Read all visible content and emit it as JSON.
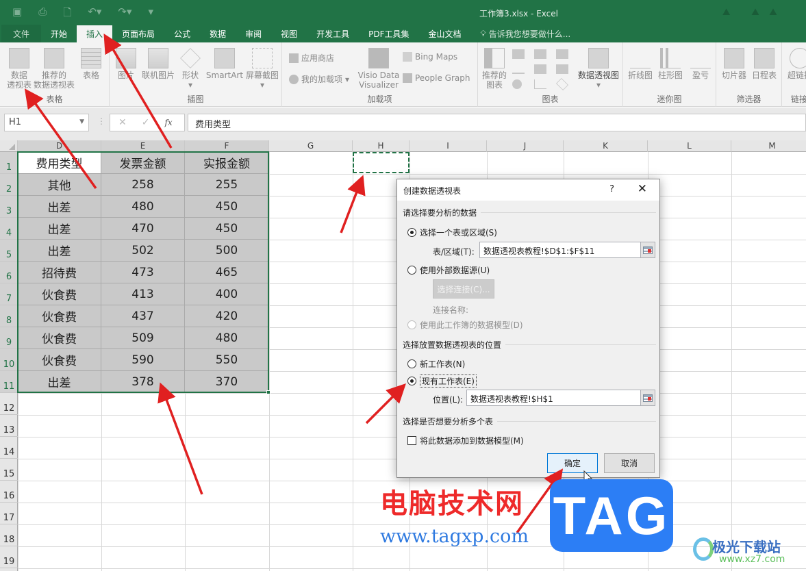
{
  "window": {
    "title": "工作簿3.xlsx - Excel"
  },
  "quick_access": [
    "save-icon",
    "print-preview-icon",
    "print-icon",
    "undo-icon",
    "redo-icon",
    "customize-icon"
  ],
  "tabs": [
    {
      "label": "文件",
      "type": "file"
    },
    {
      "label": "开始"
    },
    {
      "label": "插入",
      "active": true
    },
    {
      "label": "页面布局"
    },
    {
      "label": "公式"
    },
    {
      "label": "数据"
    },
    {
      "label": "审阅"
    },
    {
      "label": "视图"
    },
    {
      "label": "开发工具"
    },
    {
      "label": "PDF工具集"
    },
    {
      "label": "金山文档"
    }
  ],
  "tell_me": "告诉我您想要做什么...",
  "ribbon": {
    "groups": {
      "tables": "表格",
      "illustrations": "插图",
      "addins": "加载项",
      "charts": "图表",
      "sparklines": "迷你图",
      "filters": "筛选器",
      "links": "链接"
    },
    "pivot_table": [
      "数据",
      "透视表"
    ],
    "recommended_pivot": [
      "推荐的",
      "数据透视表"
    ],
    "table": "表格",
    "picture": "图片",
    "online_picture": "联机图片",
    "shapes": "形状",
    "smartart": "SmartArt",
    "screenshot": "屏幕截图",
    "store": "应用商店",
    "my_addins": "我的加载项",
    "visio": [
      "Visio Data",
      "Visualizer"
    ],
    "bing_maps": "Bing Maps",
    "people_graph": "People Graph",
    "recommended_charts": [
      "推荐的",
      "图表"
    ],
    "pivot_chart": "数据透视图",
    "line": "折线图",
    "column": "柱形图",
    "winloss": "盈亏",
    "slicer": "切片器",
    "timeline": "日程表",
    "hyperlink": "超链接"
  },
  "formula_bar": {
    "name_box": "H1",
    "formula": "费用类型",
    "fx": "fx",
    "cancel": "✕",
    "enter": "✓"
  },
  "columns": [
    "D",
    "E",
    "F",
    "G",
    "H",
    "I",
    "J",
    "K",
    "L",
    "M"
  ],
  "rows": [
    "1",
    "2",
    "3",
    "4",
    "5",
    "6",
    "7",
    "8",
    "9",
    "10",
    "11",
    "12",
    "13",
    "14",
    "15",
    "16",
    "17",
    "18",
    "19"
  ],
  "table": {
    "headers": [
      "费用类型",
      "发票金额",
      "实报金额"
    ],
    "rows": [
      [
        "其他",
        "258",
        "255"
      ],
      [
        "出差",
        "480",
        "450"
      ],
      [
        "出差",
        "470",
        "450"
      ],
      [
        "出差",
        "502",
        "500"
      ],
      [
        "招待费",
        "473",
        "465"
      ],
      [
        "伙食费",
        "413",
        "400"
      ],
      [
        "伙食费",
        "437",
        "420"
      ],
      [
        "伙食费",
        "509",
        "480"
      ],
      [
        "伙食费",
        "590",
        "550"
      ],
      [
        "出差",
        "378",
        "370"
      ]
    ]
  },
  "dialog": {
    "title": "创建数据透视表",
    "help": "?",
    "close": "✕",
    "section1": "请选择要分析的数据",
    "opt_select_range": "选择一个表或区域(S)",
    "range_label": "表/区域(T):",
    "range_value": "数据透视表教程!$D$1:$F$11",
    "opt_external": "使用外部数据源(U)",
    "choose_conn": "选择连接(C)...",
    "conn_name": "连接名称:",
    "opt_data_model": "使用此工作簿的数据模型(D)",
    "section2": "选择放置数据透视表的位置",
    "opt_new_sheet": "新工作表(N)",
    "opt_existing": "现有工作表(E)",
    "location_label": "位置(L):",
    "location_value": "数据透视表教程!$H$1",
    "section3": "选择是否想要分析多个表",
    "add_to_model": "将此数据添加到数据模型(M)",
    "ok": "确定",
    "cancel": "取消",
    "selected_source": "select_range",
    "selected_location": "existing",
    "add_to_model_checked": false
  },
  "watermark": {
    "cn": "电脑技术网",
    "url": "www.tagxp.com",
    "tag": "TAG",
    "xz": "极光下载站",
    "xz_url": "www.xz7.com"
  },
  "colors": {
    "excel_green": "#217346",
    "arrow_red": "#e02020",
    "tag_blue": "#2c7ef5"
  }
}
